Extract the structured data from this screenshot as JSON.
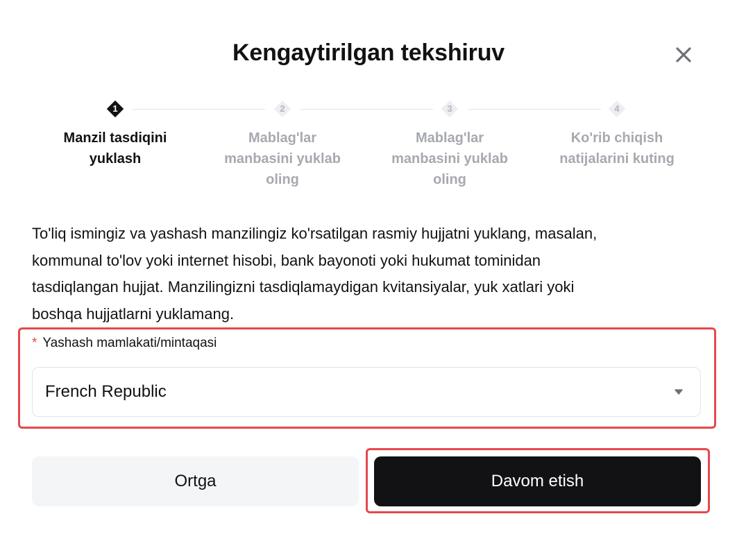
{
  "dialog": {
    "title": "Kengaytirilgan tekshiruv",
    "close_icon": "close-icon"
  },
  "stepper": {
    "steps": [
      {
        "number": "1",
        "label_lines": [
          "Manzil tasdiqini",
          "yuklash"
        ],
        "state": "active"
      },
      {
        "number": "2",
        "label_lines": [
          "Mablag'lar",
          "manbasini yuklab",
          "oling"
        ],
        "state": "inactive"
      },
      {
        "number": "3",
        "label_lines": [
          "Mablag'lar",
          "manbasini yuklab",
          "oling"
        ],
        "state": "inactive"
      },
      {
        "number": "4",
        "label_lines": [
          "Ko'rib chiqish",
          "natijalarini kuting"
        ],
        "state": "inactive"
      }
    ]
  },
  "description": {
    "lines": [
      "To'liq ismingiz va yashash manzilingiz ko'rsatilgan rasmiy hujjatni yuklang, masalan,",
      "kommunal to'lov yoki internet hisobi, bank bayonoti yoki hukumat tominidan",
      "tasdiqlangan hujjat. Manzilingizni tasdiqlamaydigan kvitansiyalar, yuk xatlari yoki",
      "boshqa hujjatlarni yuklamang."
    ]
  },
  "field": {
    "required_mark": "*",
    "label": "Yashash mamlakati/mintaqasi",
    "value": "French Republic",
    "dropdown_icon": "caret-down-icon"
  },
  "actions": {
    "back_label": "Ortga",
    "continue_label": "Davom etish"
  },
  "colors": {
    "primary": "#121214",
    "muted": "#a7a9b0",
    "highlight": "#e5484d",
    "secondary_bg": "#f4f5f7"
  }
}
